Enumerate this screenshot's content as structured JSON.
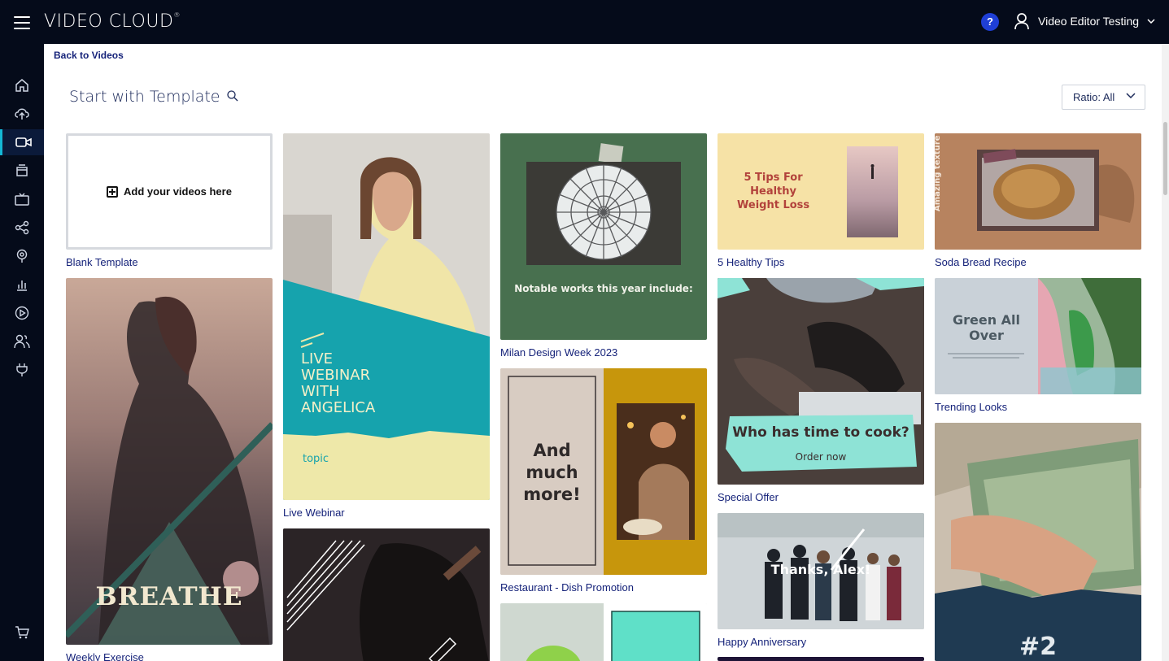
{
  "app": {
    "brand": "VIDEO CLOUD",
    "brand_mark": "®",
    "help_label": "?",
    "user_name": "Video Editor Testing"
  },
  "sidebar": {
    "items": [
      {
        "icon": "home-icon"
      },
      {
        "icon": "upload-icon"
      },
      {
        "icon": "video-camera-icon",
        "active": true
      },
      {
        "icon": "media-library-icon"
      },
      {
        "icon": "tv-icon"
      },
      {
        "icon": "share-icon"
      },
      {
        "icon": "live-icon"
      },
      {
        "icon": "analytics-icon"
      },
      {
        "icon": "player-icon"
      },
      {
        "icon": "users-icon"
      },
      {
        "icon": "plugin-icon"
      },
      {
        "icon": "cart-icon"
      }
    ]
  },
  "header": {
    "back_link": "Back to Videos",
    "title": "Start with Template",
    "ratio_label": "Ratio: All"
  },
  "colors": {
    "topbar": "#050b1a",
    "accent": "#14b8d6",
    "link": "#16237a",
    "help": "#1f3fd6"
  },
  "templates": {
    "blank": {
      "label": "Blank Template",
      "cta": "Add your videos here"
    },
    "weekly_exercise": {
      "label": "Weekly Exercise",
      "overlay": "BREATHE"
    },
    "live_webinar": {
      "label": "Live Webinar",
      "overlay_lines": [
        "LIVE",
        "WEBINAR",
        "WITH",
        "ANGELICA"
      ],
      "topic": "topic"
    },
    "milan": {
      "label": "Milan Design Week 2023",
      "overlay": "Notable works this year include:"
    },
    "restaurant": {
      "label": "Restaurant - Dish Promotion",
      "overlay_lines": [
        "And",
        "much",
        "more!"
      ]
    },
    "healthy_tips": {
      "label": "5 Healthy Tips",
      "overlay_lines": [
        "5 Tips For",
        "Healthy",
        "Weight Loss"
      ]
    },
    "special_offer": {
      "label": "Special Offer",
      "overlay": "Who has time to cook?",
      "sub": "Order now"
    },
    "anniversary": {
      "label": "Happy Anniversary",
      "overlay": "Thanks, Alex!"
    },
    "soda_bread": {
      "label": "Soda Bread Recipe",
      "overlay": "Amazing texture"
    },
    "trending": {
      "label": "Trending Looks",
      "overlay_lines": [
        "Green All",
        "Over"
      ]
    },
    "money": {
      "overlay": "#2"
    }
  }
}
